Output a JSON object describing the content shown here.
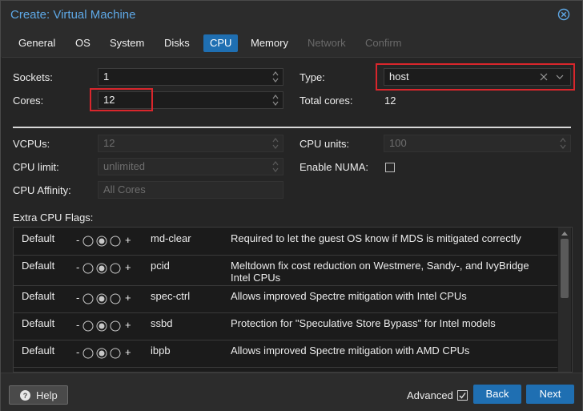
{
  "window": {
    "title": "Create: Virtual Machine"
  },
  "tabs": [
    {
      "label": "General",
      "state": "normal"
    },
    {
      "label": "OS",
      "state": "normal"
    },
    {
      "label": "System",
      "state": "normal"
    },
    {
      "label": "Disks",
      "state": "normal"
    },
    {
      "label": "CPU",
      "state": "active"
    },
    {
      "label": "Memory",
      "state": "normal"
    },
    {
      "label": "Network",
      "state": "disabled"
    },
    {
      "label": "Confirm",
      "state": "disabled"
    }
  ],
  "form": {
    "sockets_label": "Sockets:",
    "sockets_value": "1",
    "cores_label": "Cores:",
    "cores_value": "12",
    "type_label": "Type:",
    "type_value": "host",
    "total_cores_label": "Total cores:",
    "total_cores_value": "12",
    "vcpus_label": "VCPUs:",
    "vcpus_value": "12",
    "cpu_units_label": "CPU units:",
    "cpu_units_value": "100",
    "cpu_limit_label": "CPU limit:",
    "cpu_limit_value": "unlimited",
    "enable_numa_label": "Enable NUMA:",
    "cpu_affinity_label": "CPU Affinity:",
    "cpu_affinity_placeholder": "All Cores",
    "extra_flags_label": "Extra CPU Flags:"
  },
  "flags": [
    {
      "state": "Default",
      "name": "md-clear",
      "desc": "Required to let the guest OS know if MDS is mitigated correctly",
      "desc2": ""
    },
    {
      "state": "Default",
      "name": "pcid",
      "desc": "Meltdown fix cost reduction on Westmere, Sandy-, and IvyBridge",
      "desc2": "Intel CPUs"
    },
    {
      "state": "Default",
      "name": "spec-ctrl",
      "desc": "Allows improved Spectre mitigation with Intel CPUs",
      "desc2": ""
    },
    {
      "state": "Default",
      "name": "ssbd",
      "desc": "Protection for \"Speculative Store Bypass\" for Intel models",
      "desc2": ""
    },
    {
      "state": "Default",
      "name": "ibpb",
      "desc": "Allows improved Spectre mitigation with AMD CPUs",
      "desc2": ""
    }
  ],
  "tristate": {
    "minus": "-",
    "plus": "+"
  },
  "footer": {
    "help_label": "Help",
    "advanced_label": "Advanced",
    "back_label": "Back",
    "next_label": "Next"
  },
  "colors": {
    "accent": "#1f6fb2",
    "title": "#5ea8e6",
    "highlight": "#d9262c"
  }
}
